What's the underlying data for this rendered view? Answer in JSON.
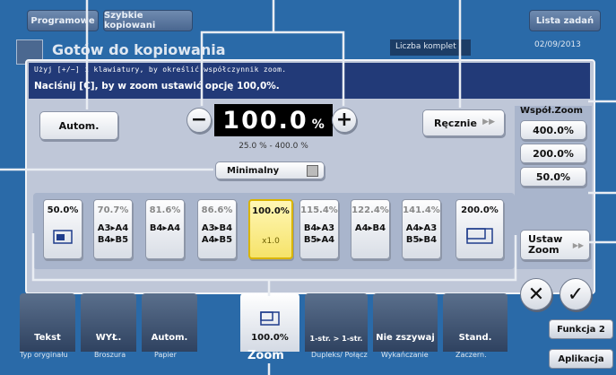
{
  "topbar": {
    "tab_programs": "Programowe",
    "tab_quickcopy": "Szybkie kopiowani",
    "tab_joblist": "Lista zadań"
  },
  "background": {
    "title": "Gotów do kopiowania",
    "copies_label": "Liczba komplet",
    "date": "02/09/2013"
  },
  "message": {
    "line1": "Użyj [+/−] i klawiatury, by określić współczynnik zoom.",
    "line2": "Naciśnij [C], by w zoom ustawić opcję 100,0%."
  },
  "controls": {
    "auto_label": "Autom.",
    "minus_symbol": "−",
    "plus_symbol": "+",
    "zoom_value": "100.0",
    "zoom_unit": "%",
    "range_text": "25.0 % - 400.0 %",
    "manual_label": "Ręcznie",
    "minimal_label": "Minimalny"
  },
  "presets": [
    {
      "pct": "50.0%",
      "size": ""
    },
    {
      "pct": "70.7%",
      "size": "A3▸A4\nB4▸B5"
    },
    {
      "pct": "81.6%",
      "size": "B4▸A4"
    },
    {
      "pct": "86.6%",
      "size": "A3▸B4\nA4▸B5"
    },
    {
      "pct": "100.0%",
      "size": "x1.0"
    },
    {
      "pct": "115.4%",
      "size": "B4▸A3\nB5▸A4"
    },
    {
      "pct": "122.4%",
      "size": "A4▸B4"
    },
    {
      "pct": "141.4%",
      "size": "A4▸A3\nB5▸B4"
    },
    {
      "pct": "200.0%",
      "size": ""
    }
  ],
  "user_zoom": {
    "title": "Współ.Zoom",
    "values": [
      "400.0%",
      "200.0%",
      "50.0%"
    ],
    "set_zoom_line1": "Ustaw",
    "set_zoom_line2": "Zoom"
  },
  "dialog_actions": {
    "cancel_symbol": "✕",
    "ok_symbol": "✓"
  },
  "bottom_tabs": [
    {
      "value": "Tekst",
      "label": "Typ oryginału"
    },
    {
      "value": "WYŁ.",
      "label": "Broszura"
    },
    {
      "value": "Autom.",
      "label": "Papier"
    },
    {
      "value": "100.0%",
      "label": "Zoom"
    },
    {
      "value": "1-str. > 1-str.",
      "label": "Dupleks/ Połącz"
    },
    {
      "value": "Nie zszywaj",
      "label": "Wykańczanie"
    },
    {
      "value": "Stand.",
      "label": "Zaczern."
    }
  ],
  "right_buttons": {
    "function2": "Funkcja 2",
    "application": "Aplikacja"
  },
  "colors": {
    "screen_bg": "#2a6aa8",
    "message_bg": "#223a78",
    "selected_preset": "#f6e36a",
    "callout_lines": "#e9edf3"
  }
}
